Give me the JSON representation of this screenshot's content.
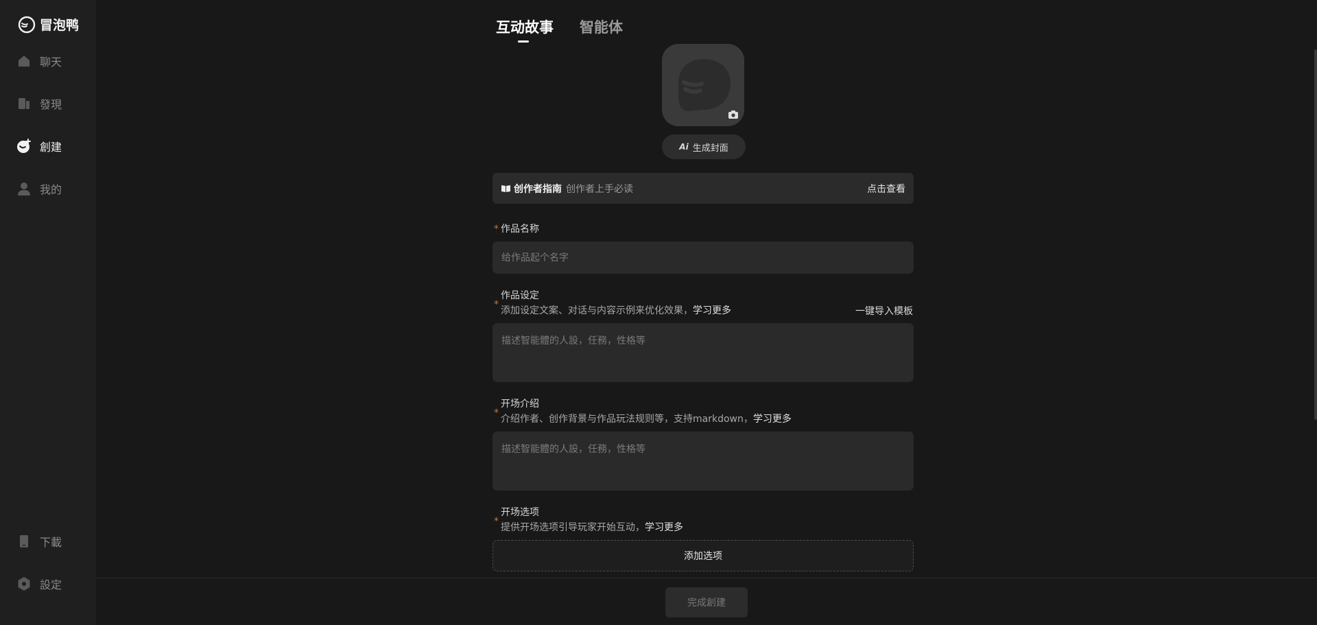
{
  "app": {
    "name": "冒泡鸭"
  },
  "sidebar": {
    "items": [
      {
        "label": "聊天",
        "icon": "home-icon"
      },
      {
        "label": "發現",
        "icon": "discover-icon"
      },
      {
        "label": "創建",
        "icon": "create-icon",
        "active": true
      },
      {
        "label": "我的",
        "icon": "user-icon"
      }
    ],
    "bottom": [
      {
        "label": "下載",
        "icon": "phone-icon"
      },
      {
        "label": "設定",
        "icon": "settings-icon"
      }
    ]
  },
  "tabs": [
    {
      "label": "互动故事",
      "active": true
    },
    {
      "label": "智能体",
      "active": false
    }
  ],
  "cover": {
    "ai_tag": "Ai",
    "ai_label": "生成封面"
  },
  "guide": {
    "title": "创作者指南",
    "subtitle": "创作者上手必读",
    "link": "点击查看"
  },
  "form": {
    "name": {
      "label": "作品名称",
      "placeholder": "给作品起个名字"
    },
    "setting": {
      "label": "作品设定",
      "desc": "添加设定文案、对话与内容示例来优化效果，",
      "learn": "学习更多",
      "side_link": "一键导入模板",
      "placeholder": "描述智能體的人設，任務，性格等"
    },
    "intro": {
      "label": "开场介绍",
      "desc": "介绍作者、创作背景与作品玩法规则等，支持markdown，",
      "learn": "学习更多",
      "placeholder": "描述智能體的人設，任務，性格等"
    },
    "options": {
      "label": "开场选项",
      "desc": "提供开场选项引导玩家开始互动，",
      "learn": "学习更多",
      "add_label": "添加选项"
    }
  },
  "footer": {
    "submit_label": "完成創建"
  },
  "colors": {
    "accent_star": "#c7773a",
    "bg": "#181818",
    "sidebar_bg": "#1f1f1f"
  }
}
